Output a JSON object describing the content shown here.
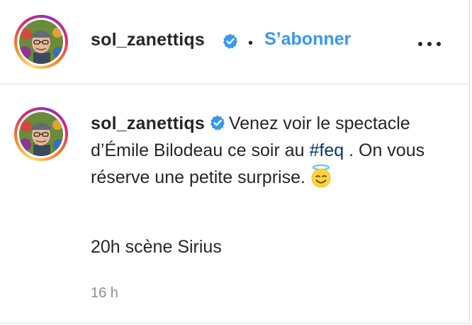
{
  "header": {
    "username": "sol_zanettiqs",
    "separator": "•",
    "follow_label": "S’abonner"
  },
  "comment": {
    "username": "sol_zanettiqs",
    "text_before_hashtag": "Venez voir le spectacle d’Émile Bilodeau ce soir au ",
    "hashtag": "#feq",
    "text_after_hashtag": " . On vous réserve une petite surprise.",
    "emoji": "smiling-face-with-halo",
    "second_paragraph": "20h scène Sirius",
    "timestamp": "16 h"
  },
  "icons": {
    "verified": "verified-badge-icon",
    "more": "more-options-icon"
  },
  "colors": {
    "follow": "#3897f0",
    "hashtag": "#00376b",
    "verified": "#3897f0",
    "text": "#262626",
    "muted": "#8e8e8e",
    "border": "#dbdbdb"
  }
}
